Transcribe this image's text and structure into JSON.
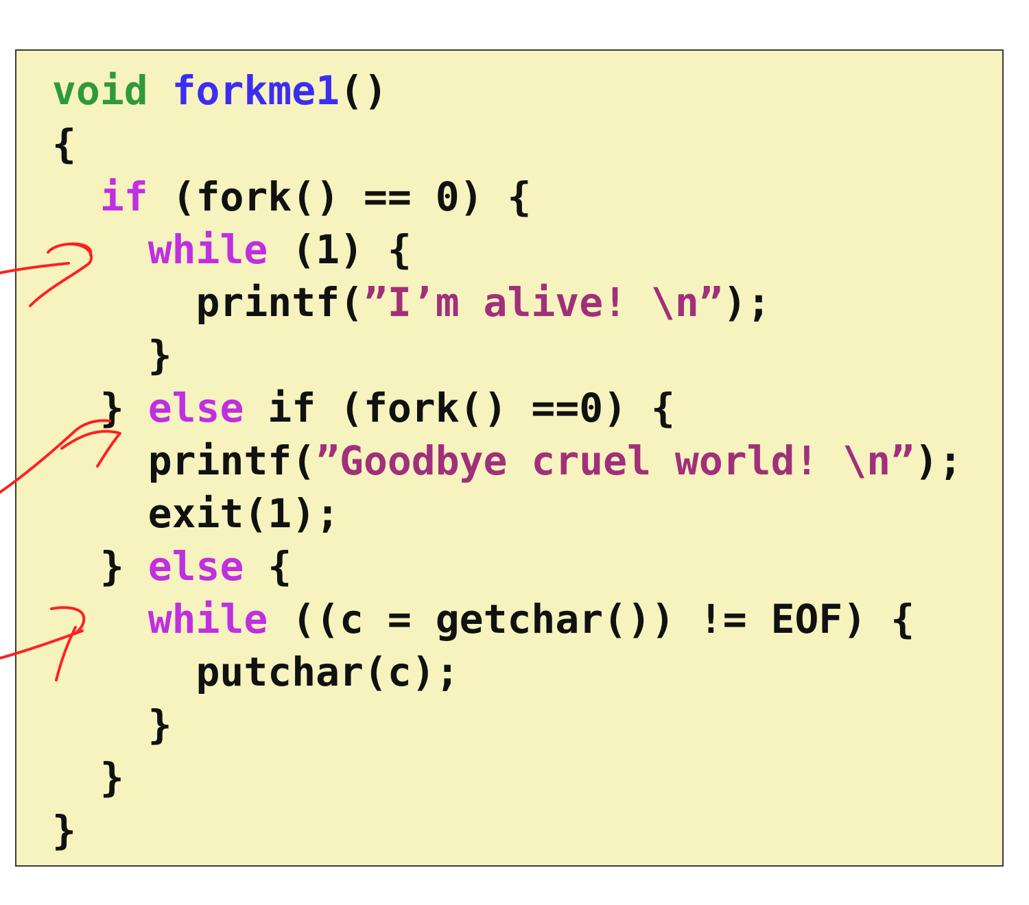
{
  "code": {
    "line1": {
      "type": "void",
      "sp": " ",
      "name": "forkme1",
      "rest": "()"
    },
    "line2": {
      "text": "{"
    },
    "line3": {
      "indent": "  ",
      "kw": "if",
      "rest": " (fork() == 0) {"
    },
    "line4": {
      "indent": "    ",
      "kw": "while",
      "rest": " (1) {"
    },
    "line5": {
      "indent": "      ",
      "pre": "printf(",
      "str": "”I’m alive! \\n”",
      "post": ");"
    },
    "line6": {
      "text": "    }"
    },
    "line7": {
      "indent": "  ",
      "pre": "} ",
      "kw": "else",
      "rest": " if (fork() ==0) {"
    },
    "line8": {
      "indent": "    ",
      "pre": "printf(",
      "str": "”Goodbye cruel world! \\n”",
      "post": ");"
    },
    "line9": {
      "text": "    exit(1);"
    },
    "line10": {
      "indent": "  ",
      "pre": "} ",
      "kw": "else",
      "rest": " {"
    },
    "line11": {
      "indent": "    ",
      "kw": "while",
      "rest": " ((c = getchar()) != EOF) {"
    },
    "line12": {
      "text": "      putchar(c);"
    },
    "line13": {
      "text": "    }"
    },
    "line14": {
      "text": "  }"
    },
    "line15": {
      "text": "}"
    }
  },
  "colors": {
    "background": "#f7f3bf",
    "type_keyword": "#2e9a3a",
    "function_name": "#3b2ef0",
    "control_keyword": "#c02fe0",
    "string_literal": "#a0307a",
    "annotation_ink": "#ff2020"
  }
}
